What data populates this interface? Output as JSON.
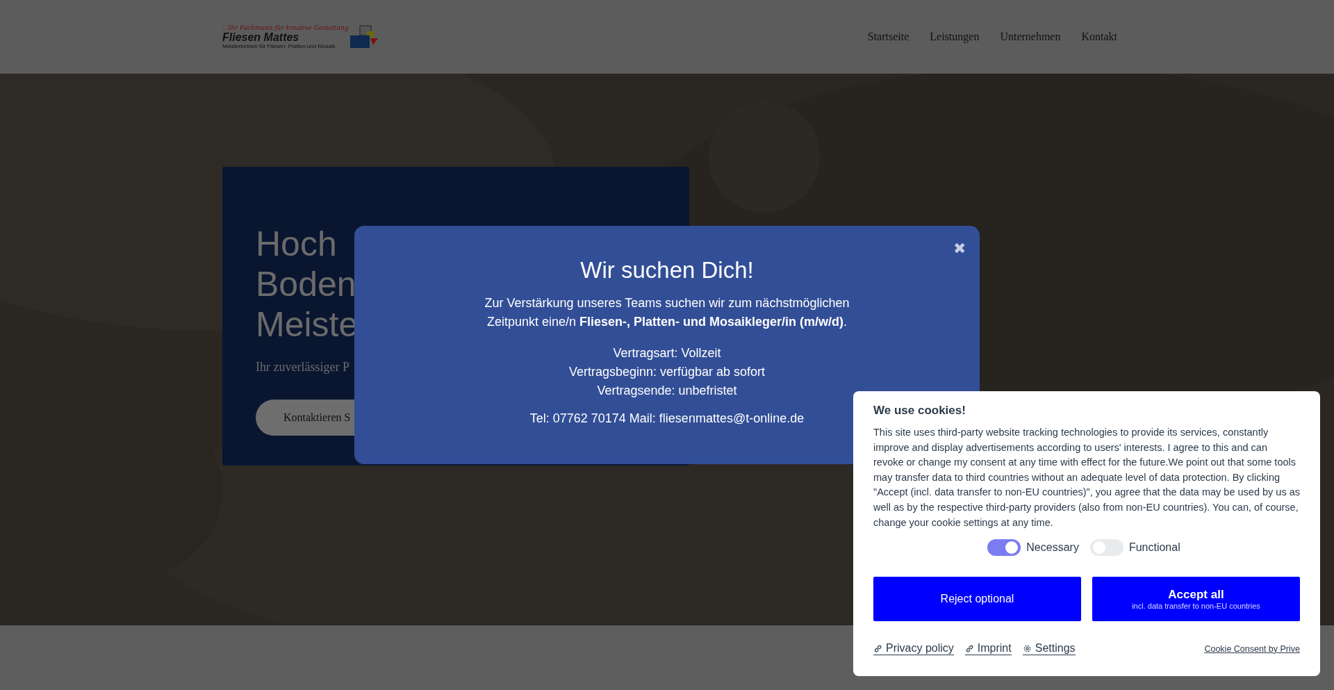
{
  "header": {
    "logo": {
      "tagline": "...Ihr Fachmann für kreative Gestaltung",
      "name": "Fliesen Mattes",
      "subtitle": "Meisterbetrieb für Fliesen, Platten und Mosaik"
    },
    "nav": [
      {
        "label": "Startseite"
      },
      {
        "label": "Leistungen"
      },
      {
        "label": "Unternehmen"
      },
      {
        "label": "Kontakt"
      }
    ]
  },
  "hero": {
    "heading_lines": [
      "Hoch",
      "Boden",
      "Meiste"
    ],
    "subtitle": "Ihr zuverlässiger P",
    "button": "Kontaktieren S"
  },
  "modal": {
    "close": "✖",
    "title": "Wir suchen Dich!",
    "intro": "Zur Verstärkung unseres Teams suchen wir zum nächstmöglichen Zeitpunkt eine/n **Fliesen-, Platten- und Mosaikleger/in (m/w/d)**.",
    "details": [
      "Vertragsart: Vollzeit",
      "Vertragsbeginn: verfügbar ab sofort",
      "Vertragsende: unbefristet"
    ],
    "contact": "Tel: 07762 70174 Mail: fliesenmattes@t-online.de"
  },
  "cookie": {
    "title": "We use cookies!",
    "text": "This site uses third-party website tracking technologies to provide its services, constantly improve and display advertisements according to users' interests. I agree to this and can revoke or change my consent at any time with effect for the future.We point out that some tools may transfer data to third countries without an adequate level of data protection. By clicking \"Accept (incl. data transfer to non-EU countries)\", you agree that the data may be used by us as well as by the respective third-party providers (also from non-EU countries). You can, of course, change your cookie settings at any time.",
    "toggles": [
      {
        "label": "Necessary",
        "on": true
      },
      {
        "label": "Functional",
        "on": false
      }
    ],
    "reject": "Reject optional",
    "accept": "Accept all",
    "accept_note": "incl. data transfer to non-EU countries",
    "links": [
      {
        "kind": "link",
        "label": "Privacy policy"
      },
      {
        "kind": "link",
        "label": "Imprint"
      },
      {
        "kind": "settings",
        "label": "Settings"
      }
    ],
    "credit": "Cookie Consent by Prive"
  }
}
